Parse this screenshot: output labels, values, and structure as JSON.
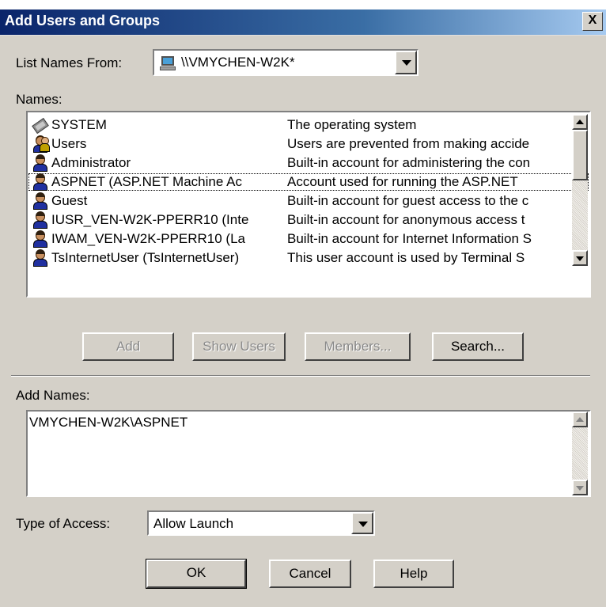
{
  "window": {
    "title": "Add Users and Groups",
    "close_glyph": "X"
  },
  "list_names_from": {
    "label": "List Names From:",
    "value": "\\\\VMYCHEN-W2K*"
  },
  "names": {
    "label": "Names:",
    "rows": [
      {
        "name": "SYSTEM",
        "description": "The operating system",
        "icon": "system-icon"
      },
      {
        "name": "Users",
        "description": "Users are prevented from making accide",
        "icon": "group-icon"
      },
      {
        "name": "Administrator",
        "description": "Built-in account for administering the con",
        "icon": "user-icon"
      },
      {
        "name": "ASPNET (ASP.NET Machine Ac",
        "description": "Account used for running the ASP.NET",
        "icon": "user-icon"
      },
      {
        "name": "Guest",
        "description": "Built-in account for guest access to the c",
        "icon": "user-icon"
      },
      {
        "name": "IUSR_VEN-W2K-PPERR10 (Inte",
        "description": "Built-in account for anonymous access t",
        "icon": "user-icon"
      },
      {
        "name": "IWAM_VEN-W2K-PPERR10 (La",
        "description": "Built-in account for Internet Information S",
        "icon": "user-icon"
      },
      {
        "name": "TsInternetUser (TsInternetUser)",
        "description": "This user account is used by Terminal S",
        "icon": "user-icon"
      }
    ]
  },
  "buttons": {
    "add": "Add",
    "show_users": "Show Users",
    "members": "Members...",
    "search": "Search..."
  },
  "add_names": {
    "label": "Add Names:",
    "value": "VMYCHEN-W2K\\ASPNET"
  },
  "type_of_access": {
    "label": "Type of Access:",
    "value": "Allow Launch"
  },
  "footer": {
    "ok": "OK",
    "cancel": "Cancel",
    "help": "Help"
  }
}
